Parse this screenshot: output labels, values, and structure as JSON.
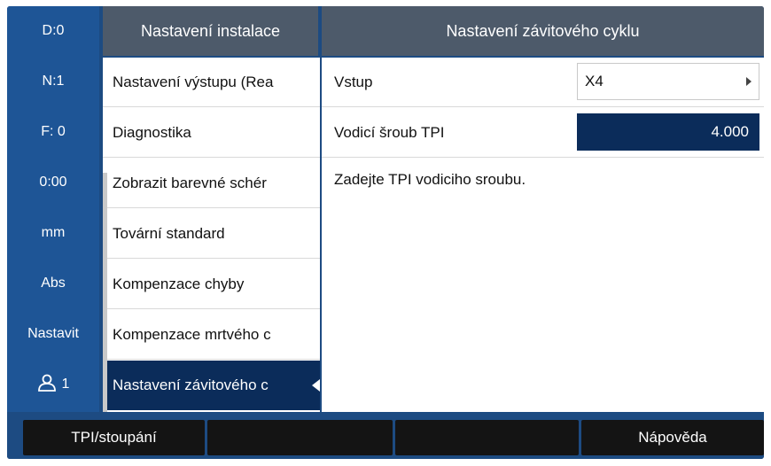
{
  "status": {
    "d": "D:0",
    "n": "N:1",
    "f": "F:  0",
    "time": "0:00",
    "unit": "mm",
    "mode": "Abs",
    "setup": "Nastavit",
    "user_number": "1",
    "user_icon": "user-icon"
  },
  "menu": {
    "title": "Nastavení instalace",
    "items": [
      {
        "label": "Nastavení výstupu (Rea"
      },
      {
        "label": "Diagnostika"
      },
      {
        "label": "Zobrazit barevné schér"
      },
      {
        "label": "Tovární standard"
      },
      {
        "label": "Kompenzace chyby"
      },
      {
        "label": "Kompenzace mrtvého c"
      },
      {
        "label": "Nastavení závitového c"
      }
    ]
  },
  "panel": {
    "title": "Nastavení závitového cyklu",
    "fields": [
      {
        "label": "Vstup",
        "value": "X4"
      },
      {
        "label": "Vodicí šroub TPI",
        "value": "4.000"
      }
    ],
    "help": "Zadejte TPI vodiciho sroubu."
  },
  "softkeys": [
    {
      "label": "TPI/stoupání"
    },
    {
      "label": ""
    },
    {
      "label": ""
    },
    {
      "label": "Nápověda"
    }
  ],
  "colors": {
    "background": "#1d4b82",
    "header": "#4d5a6a",
    "selected": "#0b2c5a",
    "softkey": "#141414"
  }
}
